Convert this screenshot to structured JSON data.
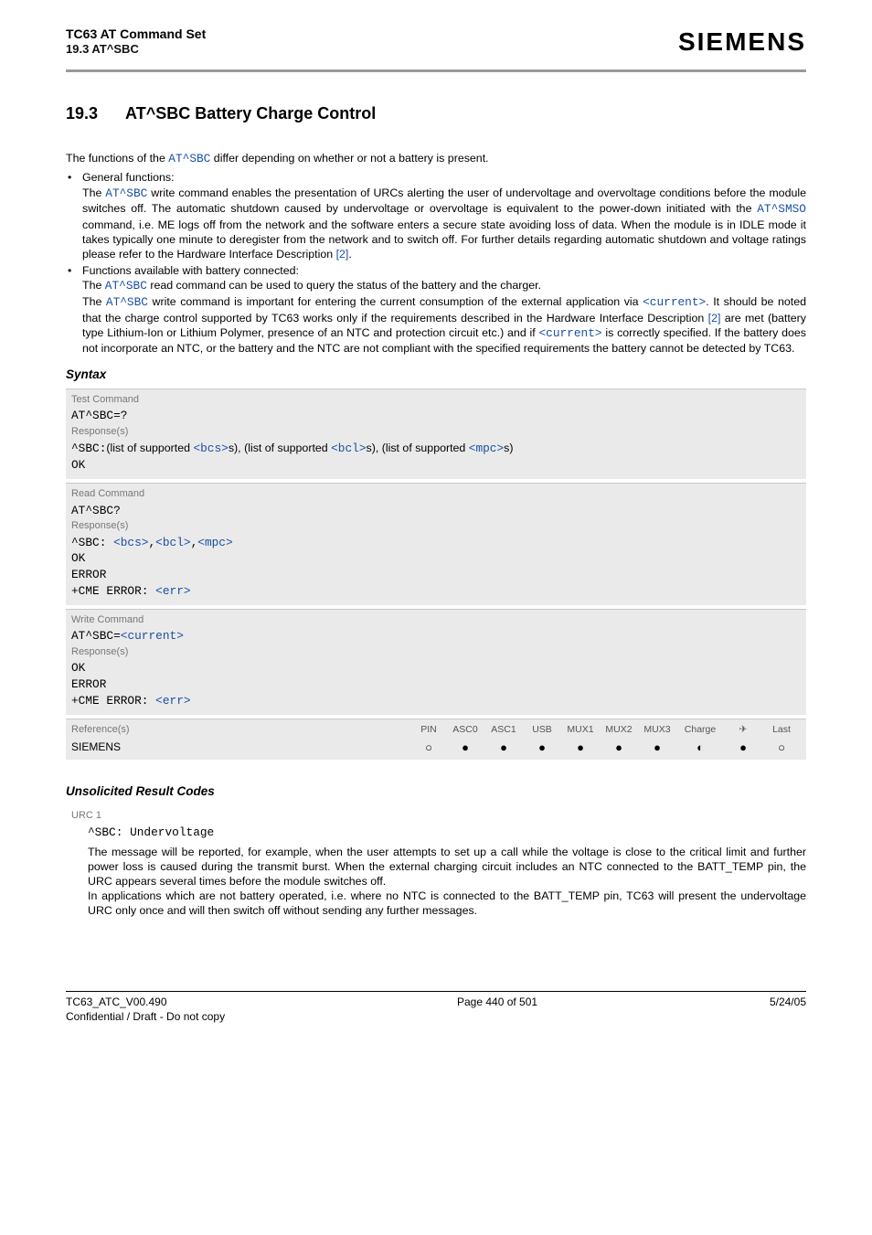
{
  "header": {
    "title": "TC63 AT Command Set",
    "subtitle": "19.3 AT^SBC",
    "logo": "SIEMENS"
  },
  "section": {
    "number": "19.3",
    "title": "AT^SBC   Battery Charge Control"
  },
  "intro": "The functions of the ",
  "intro_cmd": "AT^SBC",
  "intro_tail": " differ depending on whether or not a battery is present.",
  "bullets": [
    {
      "lead": "General functions:",
      "body_parts": [
        {
          "t": "The "
        },
        {
          "c": "AT^SBC"
        },
        {
          "t": " write command enables the presentation of URCs alerting the user of undervoltage and overvoltage conditions before the module switches off. The automatic shutdown caused by undervoltage or overvoltage is equivalent to the power-down initiated with the "
        },
        {
          "c": "AT^SMSO"
        },
        {
          "t": " command, i.e. ME logs off from the network and the software enters a secure state avoiding loss of data. When the module is in IDLE mode it takes typically one minute to deregister from the network and to switch off. For further details regarding automatic shutdown and voltage ratings please refer to the Hardware Interface Description "
        },
        {
          "r": "[2]"
        },
        {
          "t": "."
        }
      ]
    },
    {
      "lead": "Functions available with battery connected:",
      "body_parts": [
        {
          "t": "The "
        },
        {
          "c": "AT^SBC"
        },
        {
          "t": " read command can be used to query the status of the battery and the charger."
        },
        {
          "br": true
        },
        {
          "t": "The "
        },
        {
          "c": "AT^SBC"
        },
        {
          "t": " write command is important for entering the current consumption of the external application via "
        },
        {
          "c": "<current>"
        },
        {
          "t": ". It should be noted that the charge control supported by TC63 works only if the requirements described in the Hardware Interface Description "
        },
        {
          "r": "[2]"
        },
        {
          "t": " are met (battery type Lithium-Ion or Lithium Polymer, presence of an NTC and protection circuit etc.) and if "
        },
        {
          "c": "<current>"
        },
        {
          "t": " is correctly specified. If the battery does not incorporate an NTC, or the battery and the NTC are not compliant with the specified requirements the battery cannot be detected by TC63."
        }
      ]
    }
  ],
  "syntax_heading": "Syntax",
  "test_block": {
    "label": "Test Command",
    "cmd": "AT^SBC=?",
    "resp_label": "Response(s)",
    "resp_prefix": "^SBC:",
    "resp_mid1": "(list of supported ",
    "p1": "<bcs>",
    "resp_mid2": "s), (list of supported ",
    "p2": "<bcl>",
    "resp_mid3": "s), (list of supported ",
    "p3": "<mpc>",
    "resp_mid4": "s)",
    "ok": "OK"
  },
  "read_block": {
    "label": "Read Command",
    "cmd": "AT^SBC?",
    "resp_label": "Response(s)",
    "line1_pre": "^SBC: ",
    "p1": "<bcs>",
    "sep": ",",
    "p2": "<bcl>",
    "p3": "<mpc>",
    "ok": "OK",
    "error": "ERROR",
    "cme_pre": "+CME ERROR: ",
    "cme_err": "<err>"
  },
  "write_block": {
    "label": "Write Command",
    "cmd_pre": "AT^SBC=",
    "cmd_param": "<current>",
    "resp_label": "Response(s)",
    "ok": "OK",
    "error": "ERROR",
    "cme_pre": "+CME ERROR: ",
    "cme_err": "<err>"
  },
  "ref": {
    "label": "Reference(s)",
    "name": "SIEMENS",
    "cols": [
      "PIN",
      "ASC0",
      "ASC1",
      "USB",
      "MUX1",
      "MUX2",
      "MUX3",
      "Charge",
      "✈",
      "Last"
    ],
    "dots": [
      "○",
      "●",
      "●",
      "●",
      "●",
      "●",
      "●",
      "◐",
      "●",
      "○"
    ]
  },
  "urc_heading": "Unsolicited Result Codes",
  "urc": {
    "label": "URC 1",
    "code": "^SBC: Undervoltage",
    "body": "The message will be reported, for example, when the user attempts to set up a call while the voltage is close to the critical limit and further power loss is caused during the transmit burst. When the external charging circuit includes an NTC connected to the BATT_TEMP pin, the URC appears several times before the module switches off.",
    "body2": "In applications which are not battery operated, i.e. where no NTC is connected to the BATT_TEMP pin, TC63 will present the undervoltage URC only once and will then switch off without sending any further messages."
  },
  "footer": {
    "left1": "TC63_ATC_V00.490",
    "left2": "Confidential / Draft - Do not copy",
    "center": "Page 440 of 501",
    "right": "5/24/05"
  }
}
